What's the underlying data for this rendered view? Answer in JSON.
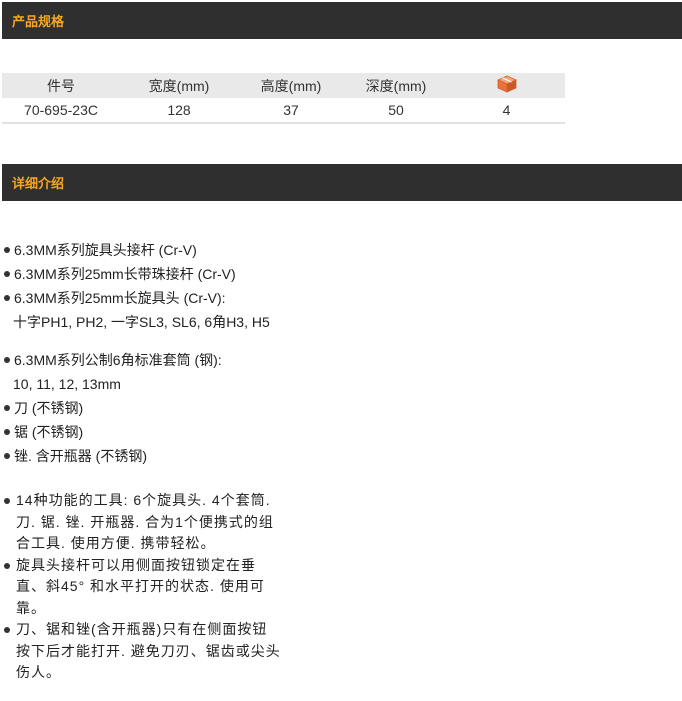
{
  "sections": {
    "spec_title": "产品规格",
    "detail_title": "详细介绍"
  },
  "spec_table": {
    "headers": [
      "件号",
      "宽度(mm)",
      "高度(mm)",
      "深度(mm)"
    ],
    "package_icon": "box-icon",
    "row": [
      "70-695-23C",
      "128",
      "37",
      "50",
      "4"
    ]
  },
  "details": {
    "items": [
      "6.3MM系列旋具头接杆 (Cr-V)",
      "6.3MM系列25mm长带珠接杆 (Cr-V)",
      "6.3MM系列25mm长旋具头 (Cr-V):",
      "6.3MM系列公制6角标准套筒 (钢):",
      "刀 (不锈钢)",
      "锯 (不锈钢)",
      "锉. 含开瓶器 (不锈钢)"
    ],
    "sub_bits": "十字PH1, PH2, 一字SL3, SL6, 6角H3, H5",
    "sub_sockets": "10, 11, 12, 13mm",
    "paragraphs": [
      "14种功能的工具: 6个旋具头. 4个套筒. 刀. 锯. 锉. 开瓶器. 合为1个便携式的组合工具. 使用方便. 携带轻松。",
      "旋具头接杆可以用侧面按钮锁定在垂直、斜45° 和水平打开的状态. 使用可靠。",
      "刀、锯和锉(含开瓶器)只有在侧面按钮按下后才能打开. 避免刀刃、锯齿或尖头伤人。"
    ]
  },
  "colors": {
    "bar_bg": "#2f2f2f",
    "bar_title": "#f5a623",
    "table_header_bg": "#e9e9e9",
    "box_orange": "#e8743b"
  }
}
